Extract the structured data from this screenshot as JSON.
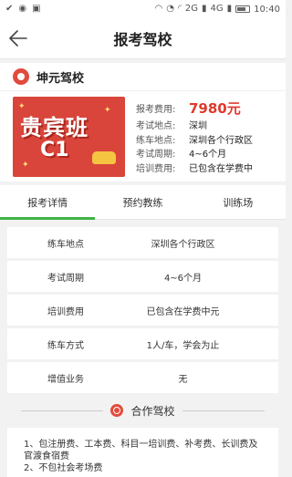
{
  "statusbar": {
    "left_icons": [
      "check-icon",
      "android-icon",
      "image-icon"
    ],
    "right_icons": [
      "headset-icon",
      "alarm-icon",
      "wifi-icon",
      "signal-2g-icon",
      "signal-4g-icon",
      "battery-icon"
    ],
    "net1": "2G",
    "net2": "4G",
    "time": "10:40"
  },
  "appbar": {
    "title": "报考驾校",
    "back_icon": "arrow-left-icon"
  },
  "school": {
    "name": "坤元驾校",
    "icon": "school-badge-icon"
  },
  "banner": {
    "line1": "贵宾班",
    "line2": "C1"
  },
  "details": [
    {
      "label": "报考费用:",
      "value": "7980元"
    },
    {
      "label": "考试地点:",
      "value": "深圳"
    },
    {
      "label": "练车地点:",
      "value": "深圳各个行政区"
    },
    {
      "label": "考试周期:",
      "value": "4~6个月"
    },
    {
      "label": "培训费用:",
      "value": "已包含在学费中"
    }
  ],
  "tabs": [
    {
      "label": "报考详情",
      "active": true
    },
    {
      "label": "预约教练",
      "active": false
    },
    {
      "label": "训练场",
      "active": false
    }
  ],
  "rows": [
    {
      "label": "练车地点",
      "value": "深圳各个行政区"
    },
    {
      "label": "考试周期",
      "value": "4~6个月"
    },
    {
      "label": "培训费用",
      "value": "已包含在学费中元"
    },
    {
      "label": "练车方式",
      "value": "1人/车，学会为止"
    },
    {
      "label": "增值业务",
      "value": "无"
    }
  ],
  "section": {
    "title": "合作驾校",
    "icon": "handshake-icon"
  },
  "notes": {
    "line1": "1、包注册费、工本费、科目一培训费、补考费、长训费及官渡食宿费",
    "line2": "2、不包社会考场费"
  },
  "colors": {
    "accent_green": "#3fb54a",
    "price_red": "#e03a2e",
    "brand_red": "#e14b3d"
  }
}
